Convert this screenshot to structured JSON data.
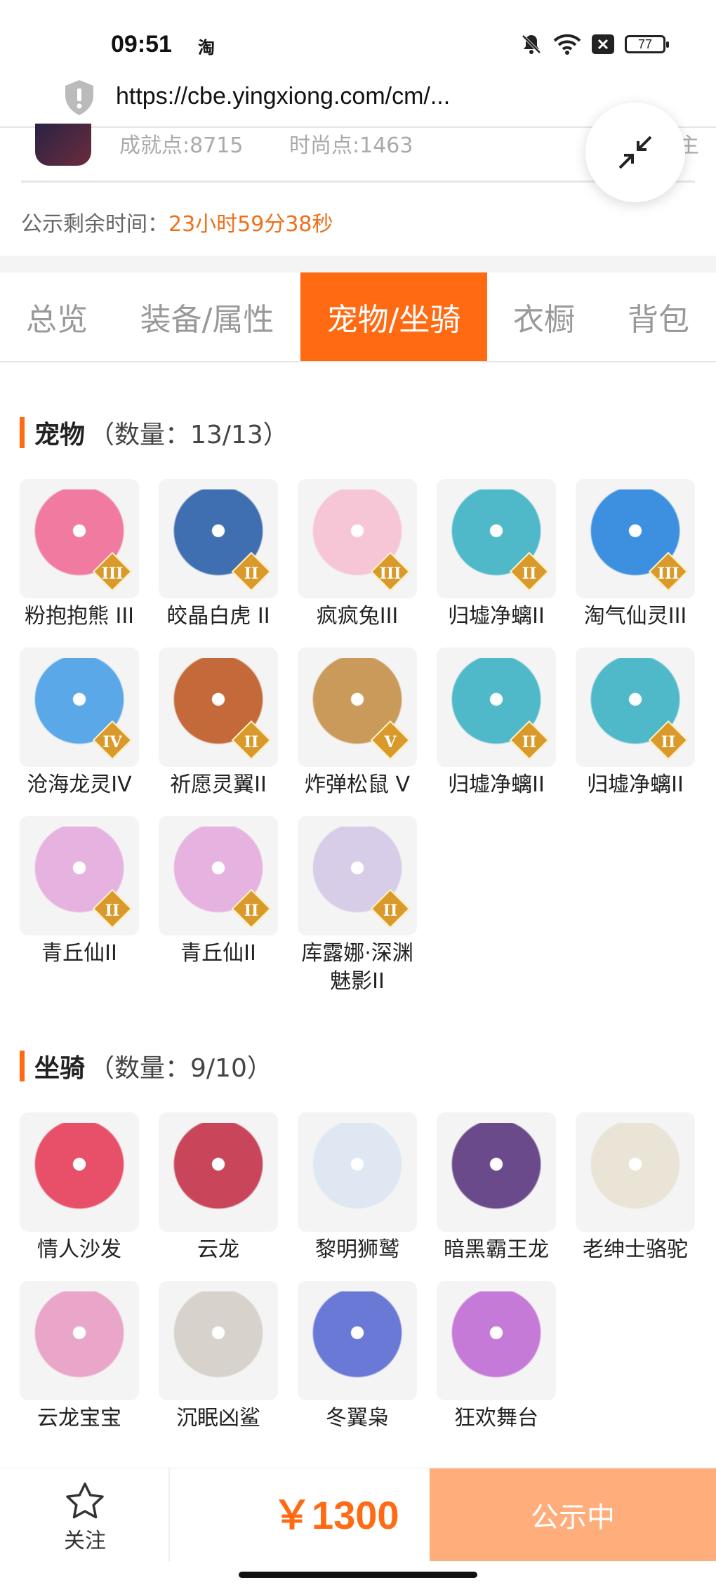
{
  "status_bar": {
    "time": "09:51",
    "app_badge": "淘",
    "battery": "77"
  },
  "url_bar": {
    "url": "https://cbe.yingxiong.com/cm/..."
  },
  "profile": {
    "achievement": "成就点:8715",
    "fashion": "时尚点:1463",
    "cut_text": "主"
  },
  "countdown": {
    "label": "公示剩余时间：",
    "value": "23小时59分38秒"
  },
  "tabs": [
    "总览",
    "装备/属性",
    "宠物/坐骑",
    "衣橱",
    "背包"
  ],
  "active_tab": 2,
  "pets": {
    "title": "宠物",
    "count": "（数量：13/13）",
    "items": [
      {
        "name": "粉抱抱熊 III",
        "tier": "III",
        "color": "#f07aa0"
      },
      {
        "name": "皎晶白虎 II",
        "tier": "II",
        "color": "#3f6fb0"
      },
      {
        "name": "疯疯兔III",
        "tier": "III",
        "color": "#f6c6d6"
      },
      {
        "name": "归墟净螭II",
        "tier": "II",
        "color": "#4fb8c9"
      },
      {
        "name": "淘气仙灵III",
        "tier": "III",
        "color": "#3d8fe0"
      },
      {
        "name": "沧海龙灵IV",
        "tier": "IV",
        "color": "#5aa8e8"
      },
      {
        "name": "祈愿灵翼II",
        "tier": "II",
        "color": "#c46a3a"
      },
      {
        "name": "炸弹松鼠 V",
        "tier": "V",
        "color": "#c99a5a"
      },
      {
        "name": "归墟净螭II",
        "tier": "II",
        "color": "#4fb8c9"
      },
      {
        "name": "归墟净螭II",
        "tier": "II",
        "color": "#4fb8c9"
      },
      {
        "name": "青丘仙II",
        "tier": "II",
        "color": "#e6b3e0"
      },
      {
        "name": "青丘仙II",
        "tier": "II",
        "color": "#e6b3e0"
      },
      {
        "name": "库露娜·深渊魅影II",
        "tier": "II",
        "color": "#d7cde8"
      }
    ]
  },
  "mounts": {
    "title": "坐骑",
    "count": "（数量：9/10）",
    "items": [
      {
        "name": "情人沙发",
        "color": "#e8506a"
      },
      {
        "name": "云龙",
        "color": "#c9465a"
      },
      {
        "name": "黎明狮鹫",
        "color": "#dfe8f2"
      },
      {
        "name": "暗黑霸王龙",
        "color": "#6a4a8a"
      },
      {
        "name": "老绅士骆驼",
        "color": "#e9e4d6"
      },
      {
        "name": "云龙宝宝",
        "color": "#e9a6c8"
      },
      {
        "name": "沉眠凶鲨",
        "color": "#d8d2cc"
      },
      {
        "name": "冬翼枭",
        "color": "#6a78d6"
      },
      {
        "name": "狂欢舞台",
        "color": "#c57ad8"
      }
    ]
  },
  "bottom_bar": {
    "follow": "关注",
    "price": "￥1300",
    "status": "公示中"
  }
}
